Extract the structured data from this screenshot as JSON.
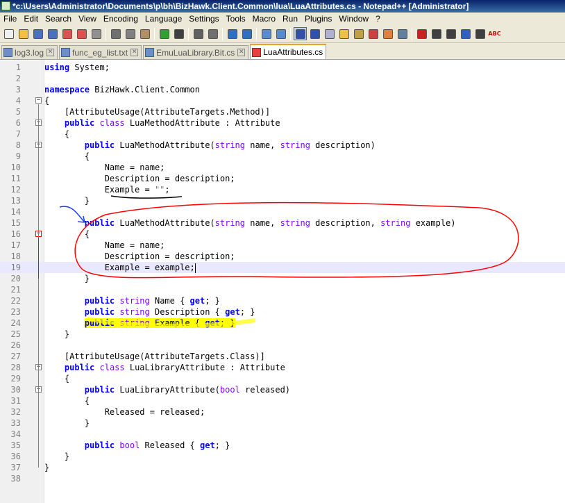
{
  "window": {
    "title": "*c:\\Users\\Administrator\\Documents\\p\\bh\\BizHawk.Client.Common\\lua\\LuaAttributes.cs - Notepad++ [Administrator]"
  },
  "menu": [
    "File",
    "Edit",
    "Search",
    "View",
    "Encoding",
    "Language",
    "Settings",
    "Tools",
    "Macro",
    "Run",
    "Plugins",
    "Window",
    "?"
  ],
  "toolbar": {
    "icons": [
      "new-file-icon",
      "open-file-icon",
      "save-icon",
      "save-all-icon",
      "close-icon",
      "close-all-icon",
      "print-icon",
      "cut-icon",
      "copy-icon",
      "paste-icon",
      "undo-icon",
      "redo-icon",
      "find-icon",
      "replace-icon",
      "zoom-in-icon",
      "zoom-out-icon",
      "sync-vertical-icon",
      "sync-horizontal-icon",
      "word-wrap-icon",
      "show-all-chars-icon",
      "indent-guide-icon",
      "user-language-icon",
      "doc-map-icon",
      "function-list-icon",
      "folder-workspace-icon",
      "monitor-icon",
      "record-macro-icon",
      "stop-record-icon",
      "play-macro-icon",
      "run-macro-multiple-icon",
      "save-macro-icon",
      "spell-check-icon"
    ],
    "spell_label": "ABC"
  },
  "tabs": [
    {
      "label": "log3.log",
      "active": false
    },
    {
      "label": "func_eg_list.txt",
      "active": false
    },
    {
      "label": "EmuLuaLibrary.Bit.cs",
      "active": false
    },
    {
      "label": "LuaAttributes.cs",
      "active": true
    }
  ],
  "tab_close_glyph": "✕",
  "fold_glyphs": {
    "minus": "−"
  },
  "code_lines": [
    [
      {
        "t": "kw",
        "s": "using"
      },
      {
        "t": "",
        "s": " System;"
      }
    ],
    [],
    [
      {
        "t": "kw",
        "s": "namespace"
      },
      {
        "t": "",
        "s": " BizHawk.Client.Common"
      }
    ],
    [
      {
        "t": "",
        "s": "{"
      }
    ],
    [
      {
        "t": "",
        "s": "    [AttributeUsage(AttributeTargets.Method)]"
      }
    ],
    [
      {
        "t": "",
        "s": "    "
      },
      {
        "t": "kw",
        "s": "public"
      },
      {
        "t": "",
        "s": " "
      },
      {
        "t": "ty",
        "s": "class"
      },
      {
        "t": "",
        "s": " LuaMethodAttribute : Attribute"
      }
    ],
    [
      {
        "t": "",
        "s": "    {"
      }
    ],
    [
      {
        "t": "",
        "s": "        "
      },
      {
        "t": "kw",
        "s": "public"
      },
      {
        "t": "",
        "s": " LuaMethodAttribute("
      },
      {
        "t": "ty",
        "s": "string"
      },
      {
        "t": "",
        "s": " name, "
      },
      {
        "t": "ty",
        "s": "string"
      },
      {
        "t": "",
        "s": " description)"
      }
    ],
    [
      {
        "t": "",
        "s": "        {"
      }
    ],
    [
      {
        "t": "",
        "s": "            Name = name;"
      }
    ],
    [
      {
        "t": "",
        "s": "            Description = description;"
      }
    ],
    [
      {
        "t": "",
        "s": "            Example = "
      },
      {
        "t": "st",
        "s": "\"\""
      },
      {
        "t": "",
        "s": ";"
      }
    ],
    [
      {
        "t": "",
        "s": "        }"
      }
    ],
    [],
    [
      {
        "t": "",
        "s": "        "
      },
      {
        "t": "kw",
        "s": "public"
      },
      {
        "t": "",
        "s": " LuaMethodAttribute("
      },
      {
        "t": "ty",
        "s": "string"
      },
      {
        "t": "",
        "s": " name, "
      },
      {
        "t": "ty",
        "s": "string"
      },
      {
        "t": "",
        "s": " description, "
      },
      {
        "t": "ty",
        "s": "string"
      },
      {
        "t": "",
        "s": " example)"
      }
    ],
    [
      {
        "t": "",
        "s": "        {"
      }
    ],
    [
      {
        "t": "",
        "s": "            Name = name;"
      }
    ],
    [
      {
        "t": "",
        "s": "            Description = description;"
      }
    ],
    [
      {
        "t": "",
        "s": "            Example = example;"
      }
    ],
    [
      {
        "t": "",
        "s": "        }"
      }
    ],
    [],
    [
      {
        "t": "",
        "s": "        "
      },
      {
        "t": "kw",
        "s": "public"
      },
      {
        "t": "",
        "s": " "
      },
      {
        "t": "ty",
        "s": "string"
      },
      {
        "t": "",
        "s": " Name { "
      },
      {
        "t": "kw",
        "s": "get"
      },
      {
        "t": "",
        "s": "; }"
      }
    ],
    [
      {
        "t": "",
        "s": "        "
      },
      {
        "t": "kw",
        "s": "public"
      },
      {
        "t": "",
        "s": " "
      },
      {
        "t": "ty",
        "s": "string"
      },
      {
        "t": "",
        "s": " Description { "
      },
      {
        "t": "kw",
        "s": "get"
      },
      {
        "t": "",
        "s": "; }"
      }
    ],
    [
      {
        "t": "",
        "s": "        "
      },
      {
        "t": "kw hl",
        "s": "public"
      },
      {
        "t": "hl",
        "s": " "
      },
      {
        "t": "ty hl",
        "s": "string"
      },
      {
        "t": "hl",
        "s": " Example { "
      },
      {
        "t": "kw hl",
        "s": "get"
      },
      {
        "t": "hl",
        "s": "; }"
      }
    ],
    [
      {
        "t": "",
        "s": "    }"
      }
    ],
    [],
    [
      {
        "t": "",
        "s": "    [AttributeUsage(AttributeTargets.Class)]"
      }
    ],
    [
      {
        "t": "",
        "s": "    "
      },
      {
        "t": "kw",
        "s": "public"
      },
      {
        "t": "",
        "s": " "
      },
      {
        "t": "ty",
        "s": "class"
      },
      {
        "t": "",
        "s": " LuaLibraryAttribute : Attribute"
      }
    ],
    [
      {
        "t": "",
        "s": "    {"
      }
    ],
    [
      {
        "t": "",
        "s": "        "
      },
      {
        "t": "kw",
        "s": "public"
      },
      {
        "t": "",
        "s": " LuaLibraryAttribute("
      },
      {
        "t": "ty",
        "s": "bool"
      },
      {
        "t": "",
        "s": " released)"
      }
    ],
    [
      {
        "t": "",
        "s": "        {"
      }
    ],
    [
      {
        "t": "",
        "s": "            Released = released;"
      }
    ],
    [
      {
        "t": "",
        "s": "        }"
      }
    ],
    [],
    [
      {
        "t": "",
        "s": "        "
      },
      {
        "t": "kw",
        "s": "public"
      },
      {
        "t": "",
        "s": " "
      },
      {
        "t": "ty",
        "s": "bool"
      },
      {
        "t": "",
        "s": " Released { "
      },
      {
        "t": "kw",
        "s": "get"
      },
      {
        "t": "",
        "s": "; }"
      }
    ],
    [
      {
        "t": "",
        "s": "    }"
      }
    ],
    [
      {
        "t": "",
        "s": "}"
      }
    ],
    []
  ],
  "current_line": 19,
  "caret_after_line": 19,
  "fold_markers": {
    "4": "black",
    "6": "black",
    "8": "black",
    "16": "red",
    "28": "black",
    "30": "black"
  },
  "colors": {
    "keyword": "#0000ff",
    "type": "#8000ff",
    "string": "#808080",
    "highlight": "#ffff00",
    "annotation": "#ff0000",
    "current_line": "#e8e8ff"
  }
}
